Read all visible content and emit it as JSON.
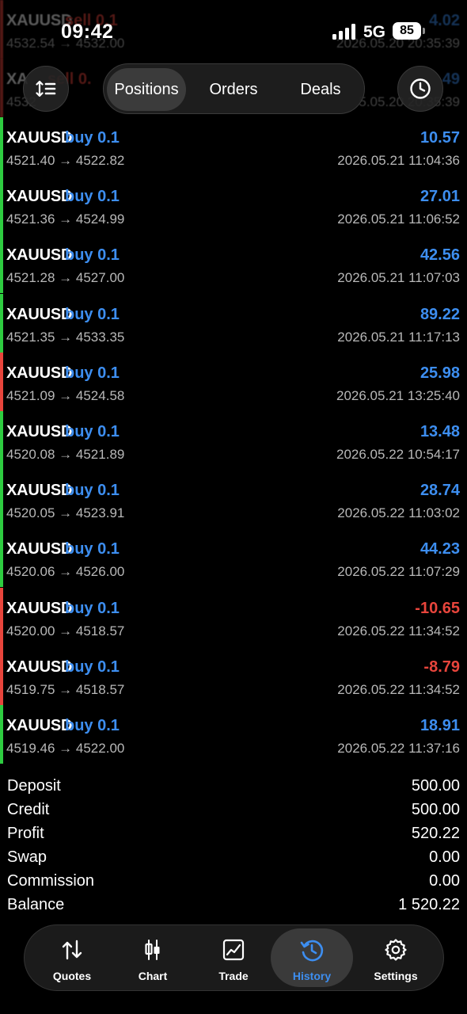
{
  "status": {
    "time": "09:42",
    "network": "5G",
    "battery": "85"
  },
  "nav": {
    "tabs": [
      "Positions",
      "Orders",
      "Deals"
    ],
    "active_tab": "Positions"
  },
  "deals_faded": [
    {
      "symbol": "XAUUSD",
      "side": "sell 0.1",
      "prices": "4532.54 → 4532.00",
      "profit": "4.02",
      "date": "2026.05.20 20:35:39"
    },
    {
      "symbol": "XA",
      "side": "sell 0.",
      "prices": "4532",
      "profit": "49",
      "date": "5.05.20 20:35:39"
    }
  ],
  "deals": [
    {
      "symbol": "XAUUSD",
      "side": "buy 0.1",
      "prices": "4521.40 → 4522.82",
      "profit": "10.57",
      "date": "2026.05.21 11:04:36",
      "bar": "#2ecc40",
      "profit_color": "#3d8ef0"
    },
    {
      "symbol": "XAUUSD",
      "side": "buy 0.1",
      "prices": "4521.36 → 4524.99",
      "profit": "27.01",
      "date": "2026.05.21 11:06:52",
      "bar": "#2ecc40",
      "profit_color": "#3d8ef0"
    },
    {
      "symbol": "XAUUSD",
      "side": "buy 0.1",
      "prices": "4521.28 → 4527.00",
      "profit": "42.56",
      "date": "2026.05.21 11:07:03",
      "bar": "#2ecc40",
      "profit_color": "#3d8ef0"
    },
    {
      "symbol": "XAUUSD",
      "side": "buy 0.1",
      "prices": "4521.35 → 4533.35",
      "profit": "89.22",
      "date": "2026.05.21 11:17:13",
      "bar": "#2ecc40",
      "profit_color": "#3d8ef0"
    },
    {
      "symbol": "XAUUSD",
      "side": "buy 0.1",
      "prices": "4521.09 → 4524.58",
      "profit": "25.98",
      "date": "2026.05.21 13:25:40",
      "bar": "#e8453c",
      "profit_color": "#3d8ef0"
    },
    {
      "symbol": "XAUUSD",
      "side": "buy 0.1",
      "prices": "4520.08 → 4521.89",
      "profit": "13.48",
      "date": "2026.05.22 10:54:17",
      "bar": "#2ecc40",
      "profit_color": "#3d8ef0"
    },
    {
      "symbol": "XAUUSD",
      "side": "buy 0.1",
      "prices": "4520.05 → 4523.91",
      "profit": "28.74",
      "date": "2026.05.22 11:03:02",
      "bar": "#2ecc40",
      "profit_color": "#3d8ef0"
    },
    {
      "symbol": "XAUUSD",
      "side": "buy 0.1",
      "prices": "4520.06 → 4526.00",
      "profit": "44.23",
      "date": "2026.05.22 11:07:29",
      "bar": "#2ecc40",
      "profit_color": "#3d8ef0"
    },
    {
      "symbol": "XAUUSD",
      "side": "buy 0.1",
      "prices": "4520.00 → 4518.57",
      "profit": "-10.65",
      "date": "2026.05.22 11:34:52",
      "bar": "#e8453c",
      "profit_color": "#e8453c"
    },
    {
      "symbol": "XAUUSD",
      "side": "buy 0.1",
      "prices": "4519.75 → 4518.57",
      "profit": "-8.79",
      "date": "2026.05.22 11:34:52",
      "bar": "#e8453c",
      "profit_color": "#e8453c"
    },
    {
      "symbol": "XAUUSD",
      "side": "buy 0.1",
      "prices": "4519.46 → 4522.00",
      "profit": "18.91",
      "date": "2026.05.22 11:37:16",
      "bar": "#2ecc40",
      "profit_color": "#3d8ef0"
    }
  ],
  "summary": [
    {
      "label": "Deposit",
      "value": "500.00"
    },
    {
      "label": "Credit",
      "value": "500.00"
    },
    {
      "label": "Profit",
      "value": "520.22"
    },
    {
      "label": "Swap",
      "value": "0.00"
    },
    {
      "label": "Commission",
      "value": "0.00"
    },
    {
      "label": "Balance",
      "value": "1 520.22"
    }
  ],
  "tabbar": {
    "items": [
      {
        "label": "Quotes",
        "icon": "quotes-arrows-icon"
      },
      {
        "label": "Chart",
        "icon": "candlestick-icon"
      },
      {
        "label": "Trade",
        "icon": "trade-chart-icon"
      },
      {
        "label": "History",
        "icon": "history-clock-icon"
      },
      {
        "label": "Settings",
        "icon": "gear-icon"
      }
    ],
    "active": "History"
  },
  "colors": {
    "accent": "#3d8ef0",
    "profit_negative": "#e8453c",
    "bar_green": "#2ecc40",
    "bar_red": "#e8453c"
  }
}
